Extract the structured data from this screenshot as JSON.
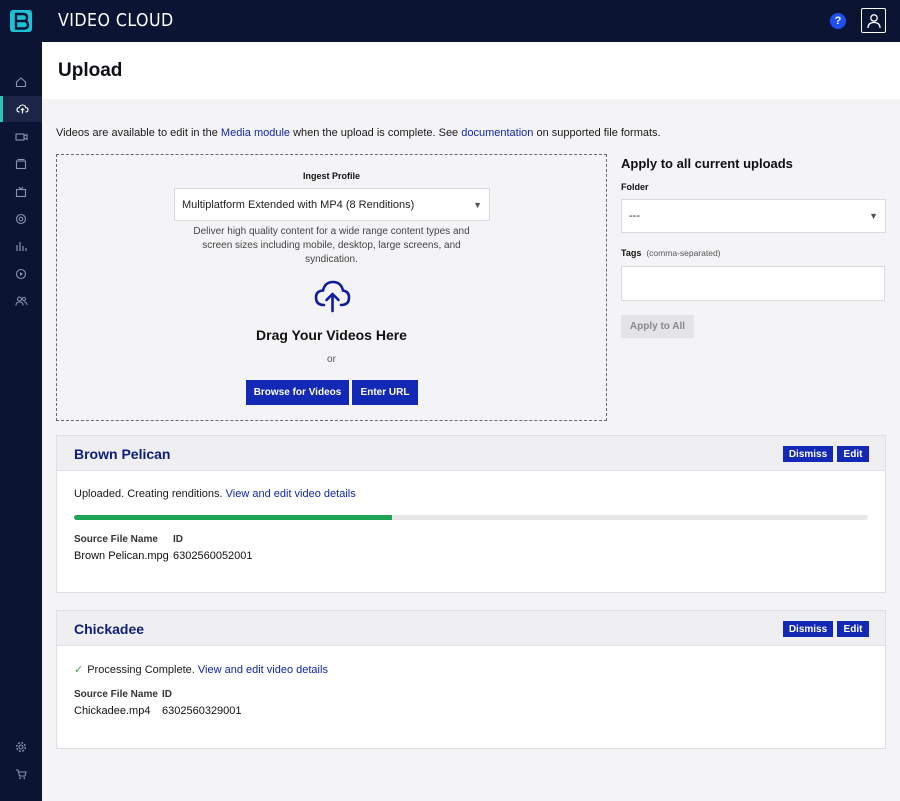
{
  "app": {
    "brand": "VIDEO CLOUD"
  },
  "header": {
    "help_label": "?"
  },
  "sidebar": {
    "items": [
      {
        "name": "home-icon"
      },
      {
        "name": "upload-icon",
        "active": true
      },
      {
        "name": "video-camera-icon"
      },
      {
        "name": "media-icon"
      },
      {
        "name": "tv-icon"
      },
      {
        "name": "globe-icon"
      },
      {
        "name": "analytics-icon"
      },
      {
        "name": "player-icon"
      },
      {
        "name": "users-icon"
      }
    ],
    "bottom_items": [
      {
        "name": "gear-icon"
      },
      {
        "name": "cart-icon"
      }
    ]
  },
  "page": {
    "title": "Upload"
  },
  "intro": {
    "prefix": "Videos are available to edit in the ",
    "media_link": "Media module",
    "middle": " when the upload is complete. See ",
    "doc_link": "documentation",
    "suffix": " on supported file formats."
  },
  "dropzone": {
    "ingest_label": "Ingest Profile",
    "ingest_value": "Multiplatform Extended with MP4 (8 Renditions)",
    "ingest_description": "Deliver high quality content for a wide range content types and screen sizes including mobile, desktop, large screens, and syndication.",
    "drag_title": "Drag Your Videos Here",
    "or": "or",
    "browse_label": "Browse for Videos",
    "url_label": "Enter URL"
  },
  "apply_panel": {
    "title": "Apply to all current uploads",
    "folder_label": "Folder",
    "folder_value": "---",
    "tags_label": "Tags",
    "tags_hint": "(comma-separated)",
    "tags_value": "",
    "apply_label": "Apply to All"
  },
  "uploads": [
    {
      "title": "Brown Pelican",
      "dismiss_label": "Dismiss",
      "edit_label": "Edit",
      "status_text": "Uploaded. Creating renditions.",
      "link_text": "View and edit video details",
      "progress": 0.4,
      "source_label": "Source File Name",
      "id_label": "ID",
      "source_value": "Brown Pelican.mpg",
      "id_value": "6302560052001"
    },
    {
      "title": "Chickadee",
      "dismiss_label": "Dismiss",
      "edit_label": "Edit",
      "status_icon": "✓",
      "status_text": "Processing Complete.",
      "link_text": "View and edit video details",
      "source_label": "Source File Name",
      "id_label": "ID",
      "source_value": "Chickadee.mp4",
      "id_value": "6302560329001"
    }
  ],
  "colors": {
    "accent": "#1328b5",
    "nav_bg": "#0b1433",
    "progress": "#1fa455",
    "active_marker": "#2fc6b6"
  }
}
